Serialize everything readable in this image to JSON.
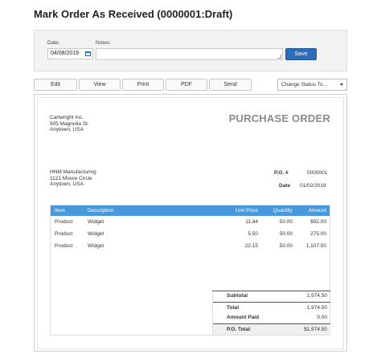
{
  "page": {
    "title": "Mark Order As Received (0000001:Draft)"
  },
  "receive_form": {
    "date_label": "Date:",
    "date_value": "04/08/2019",
    "notes_label": "Notes:",
    "notes_value": "",
    "save_label": "Save"
  },
  "toolbar": {
    "buttons": [
      "Edit",
      "View",
      "Print",
      "PDF",
      "Send"
    ],
    "status_select": "Change Status To..."
  },
  "purchase_order": {
    "heading": "PURCHASE ORDER",
    "from": {
      "name": "Cartwright Inc.",
      "street": "505 Magnolia St.",
      "city": "Anytown, USA"
    },
    "to": {
      "name": "HNM Manufacturing",
      "street": "1121 Moore Circle",
      "city": "Anytown, USA"
    },
    "po_label": "P.O. #",
    "po_number": "0000001",
    "date_label": "Date",
    "date_value": "01/02/2019",
    "columns": [
      "Item",
      "Description",
      "Unit Price",
      "Quantity",
      "Amount"
    ],
    "rows": [
      {
        "item": "Product",
        "description": "Widget",
        "unit_price": "11.84",
        "quantity": "50.00",
        "amount": "$92.00"
      },
      {
        "item": "Product",
        "description": "Widget",
        "unit_price": "5.50",
        "quantity": "50.00",
        "amount": "275.00"
      },
      {
        "item": "Product",
        "description": "Widget",
        "unit_price": "22.15",
        "quantity": "50.00",
        "amount": "1,107.50"
      }
    ],
    "totals": {
      "subtotal_label": "Subtotal",
      "subtotal": "1,974.50",
      "total_label": "Total",
      "total": "1,974.50",
      "paid_label": "Amount Paid",
      "paid": "0.00",
      "po_total_label": "P.O. Total",
      "po_total": "$1,974.50"
    }
  },
  "colors": {
    "accent": "#2c6cb8",
    "table_header": "#4a98dc",
    "heading_gray": "#8a8a8a"
  }
}
